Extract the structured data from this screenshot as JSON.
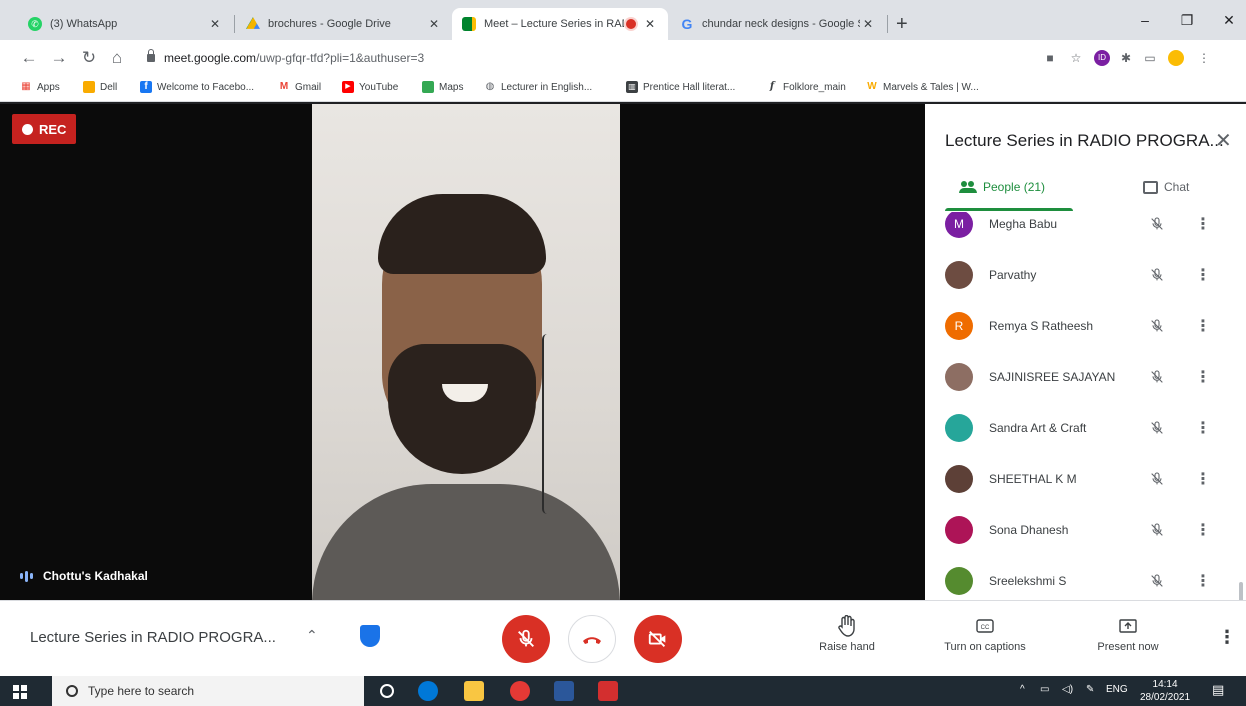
{
  "browser": {
    "tabs": [
      {
        "title": "(3) WhatsApp",
        "favicon": "whatsapp-icon"
      },
      {
        "title": "brochures - Google Drive",
        "favicon": "google-drive-icon"
      },
      {
        "title": "Meet – Lecture Series in RAD",
        "favicon": "google-meet-icon",
        "active": true
      },
      {
        "title": "chundar neck designs - Google S",
        "favicon": "google-icon"
      }
    ],
    "url_host": "meet.google.com",
    "url_path": "/uwp-gfqr-tfd?pli=1&authuser=3",
    "bookmarks": [
      {
        "label": "Apps",
        "icon": "apps-grid-icon",
        "color": "#ea4335"
      },
      {
        "label": "Dell",
        "icon": "folder-icon",
        "color": "#f9ab00"
      },
      {
        "label": "Welcome to Facebo...",
        "icon": "facebook-icon",
        "color": "#1877f2"
      },
      {
        "label": "Gmail",
        "icon": "gmail-icon",
        "color": "#ea4335"
      },
      {
        "label": "YouTube",
        "icon": "youtube-icon",
        "color": "#ff0000"
      },
      {
        "label": "Maps",
        "icon": "maps-icon",
        "color": "#34a853"
      },
      {
        "label": "Lecturer in English...",
        "icon": "globe-icon",
        "color": "#5f6368"
      },
      {
        "label": "Prentice Hall literat...",
        "icon": "book-icon",
        "color": "#3c4043"
      },
      {
        "label": "Folklore_main",
        "icon": "f-icon",
        "color": "#202124"
      },
      {
        "label": "Marvels & Tales | W...",
        "icon": "w-icon",
        "color": "#f9ab00"
      }
    ]
  },
  "meet": {
    "rec_label": "REC",
    "speaker_name": "Chottu's Kadhakal",
    "panel": {
      "title": "Lecture Series in RADIO PROGRA...",
      "people_tab": "People (21)",
      "chat_tab": "Chat",
      "participants": [
        {
          "name": "Megha Babu",
          "initial": "M",
          "avatar_color": "#7b1fa2"
        },
        {
          "name": "Parvathy",
          "initial": "",
          "avatar_color": "#6d4c41"
        },
        {
          "name": "Remya S Ratheesh",
          "initial": "R",
          "avatar_color": "#ef6c00"
        },
        {
          "name": "SAJINISREE SAJAYAN",
          "initial": "",
          "avatar_color": "#8d6e63"
        },
        {
          "name": "Sandra Art & Craft",
          "initial": "",
          "avatar_color": "#26a69a"
        },
        {
          "name": "SHEETHAL K M",
          "initial": "",
          "avatar_color": "#5d4037"
        },
        {
          "name": "Sona Dhanesh",
          "initial": "",
          "avatar_color": "#ad1457"
        },
        {
          "name": "Sreelekshmi S",
          "initial": "",
          "avatar_color": "#558b2f"
        }
      ]
    },
    "bottom": {
      "meeting_title": "Lecture Series in RADIO PROGRA...",
      "raise_hand": "Raise hand",
      "captions": "Turn on captions",
      "present": "Present now"
    }
  },
  "taskbar": {
    "search_placeholder": "Type here to search",
    "lang": "ENG",
    "time": "14:14",
    "date": "28/02/2021"
  }
}
